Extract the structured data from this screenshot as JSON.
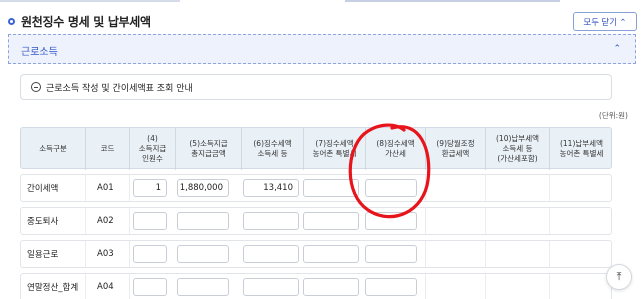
{
  "page": {
    "title": "원천징수 명세 및 납부세액",
    "collapse_all_label": "모두 닫기 ⌃"
  },
  "section": {
    "label": "근로소득",
    "chevron": "⌃"
  },
  "guide": {
    "text": "근로소득 작성 및 간이세액표 조회 안내"
  },
  "unit_label": "(단위:원)",
  "table": {
    "headers": [
      "소득구분",
      "코드",
      "(4)\n소득지급\n인원수",
      "(5)소득지급\n총지급금액",
      "(6)징수세액\n소득세 등",
      "(7)징수세액\n농어촌 특별세",
      "(8)징수세액\n가산세",
      "(9)당월조정\n환급세액",
      "(10)납부세액\n소득세 등\n(가산세포함)",
      "(11)납부세액\n농어촌 특별세"
    ],
    "rows": [
      {
        "label": "간이세액",
        "code": "A01",
        "count": "1",
        "total_paid": "1,880,000",
        "income_tax": "13,410",
        "rural_tax": "",
        "penalty": ""
      },
      {
        "label": "중도퇴사",
        "code": "A02",
        "count": "",
        "total_paid": "",
        "income_tax": "",
        "rural_tax": "",
        "penalty": ""
      },
      {
        "label": "일용근로",
        "code": "A03",
        "count": "",
        "total_paid": "",
        "income_tax": "",
        "rural_tax": "",
        "penalty": ""
      },
      {
        "label": "연말정산_합계",
        "code": "A04",
        "count": "",
        "total_paid": "",
        "income_tax": "",
        "rural_tax": "",
        "penalty": ""
      }
    ]
  },
  "scroll_top_icon": "⤒",
  "colors": {
    "accent": "#3157c8",
    "section_bg": "#eef2fc",
    "header_bg": "#e9f0f6",
    "annotation": "#e8141c"
  }
}
